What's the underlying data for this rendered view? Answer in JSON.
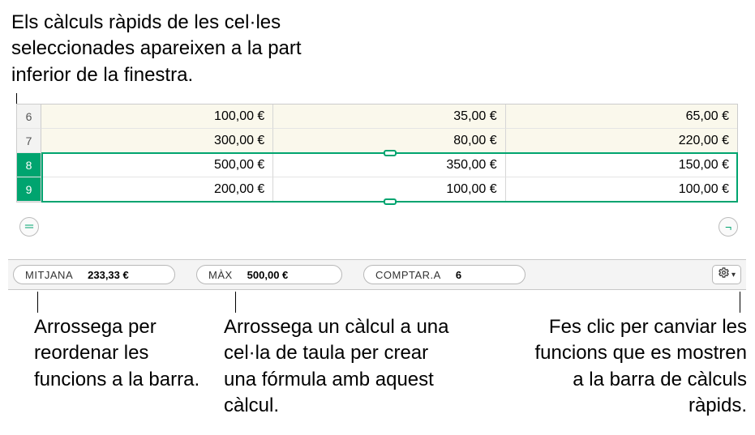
{
  "callouts": {
    "top": "Els càlculs ràpids de les cel·les seleccionades apareixen a la part inferior de la finestra.",
    "left": "Arrossega per reordenar les funcions a la barra.",
    "middle": "Arrossega un càlcul a una cel·la de taula per crear una fórmula amb aquest càlcul.",
    "right": "Fes clic per canviar les funcions que es mostren a la barra de càlculs ràpids."
  },
  "rows": [
    {
      "num": "6",
      "cells": [
        "100,00 €",
        "35,00 €",
        "65,00 €"
      ],
      "selected": false
    },
    {
      "num": "7",
      "cells": [
        "300,00 €",
        "80,00 €",
        "220,00 €"
      ],
      "selected": false
    },
    {
      "num": "8",
      "cells": [
        "500,00 €",
        "350,00 €",
        "150,00 €"
      ],
      "selected": true
    },
    {
      "num": "9",
      "cells": [
        "200,00 €",
        "100,00 €",
        "100,00 €"
      ],
      "selected": true
    }
  ],
  "quickcalc": {
    "items": [
      {
        "name": "MITJANA",
        "value": "233,33 €"
      },
      {
        "name": "MÀX",
        "value": "500,00 €"
      },
      {
        "name": "COMPTAR.A",
        "value": "6"
      }
    ]
  },
  "icons": {
    "equals": "＝",
    "corner": "⌐"
  }
}
